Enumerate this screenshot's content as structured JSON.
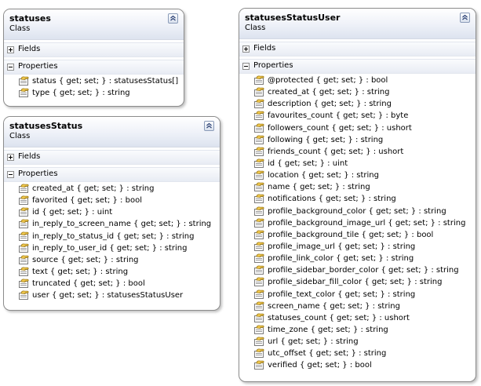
{
  "classes": [
    {
      "name": "statuses",
      "kind": "Class",
      "fields_label": "Fields",
      "properties_label": "Properties",
      "properties": [
        "status { get; set; } : statusesStatus[]",
        "type { get; set; } : string"
      ]
    },
    {
      "name": "statusesStatus",
      "kind": "Class",
      "fields_label": "Fields",
      "properties_label": "Properties",
      "properties": [
        "created_at { get; set; } : string",
        "favorited { get; set; } : bool",
        "id { get; set; } : uint",
        "in_reply_to_screen_name { get; set; } : string",
        "in_reply_to_status_id { get; set; } : string",
        "in_reply_to_user_id { get; set; } : string",
        "source { get; set; } : string",
        "text { get; set; } : string",
        "truncated { get; set; } : bool",
        "user { get; set; } : statusesStatusUser"
      ]
    },
    {
      "name": "statusesStatusUser",
      "kind": "Class",
      "fields_label": "Fields",
      "properties_label": "Properties",
      "properties": [
        "@protected { get; set; } : bool",
        "created_at { get; set; } : string",
        "description { get; set; } : string",
        "favourites_count { get; set; } : byte",
        "followers_count { get; set; } : ushort",
        "following { get; set; } : string",
        "friends_count { get; set; } : ushort",
        "id { get; set; } : uint",
        "location { get; set; } : string",
        "name { get; set; } : string",
        "notifications { get; set; } : string",
        "profile_background_color { get; set; } : string",
        "profile_background_image_url { get; set; } : string",
        "profile_background_tile { get; set; } : bool",
        "profile_image_url { get; set; } : string",
        "profile_link_color { get; set; } : string",
        "profile_sidebar_border_color { get; set; } : string",
        "profile_sidebar_fill_color { get; set; } : string",
        "profile_text_color { get; set; } : string",
        "screen_name { get; set; } : string",
        "statuses_count { get; set; } : ushort",
        "time_zone { get; set; } : string",
        "url { get; set; } : string",
        "utc_offset { get; set; } : string",
        "verified { get; set; } : bool"
      ]
    }
  ],
  "icons": {
    "collapse": "double-chevron-up-icon",
    "expand_toggle": "plus-icon",
    "collapse_toggle": "minus-icon",
    "property": "property-icon"
  },
  "colors": {
    "header_gradient_end": "#dde3ef",
    "border": "#8c8c8c",
    "property_icon_hand": "#f2c94c",
    "property_icon_card": "#ffffff"
  }
}
